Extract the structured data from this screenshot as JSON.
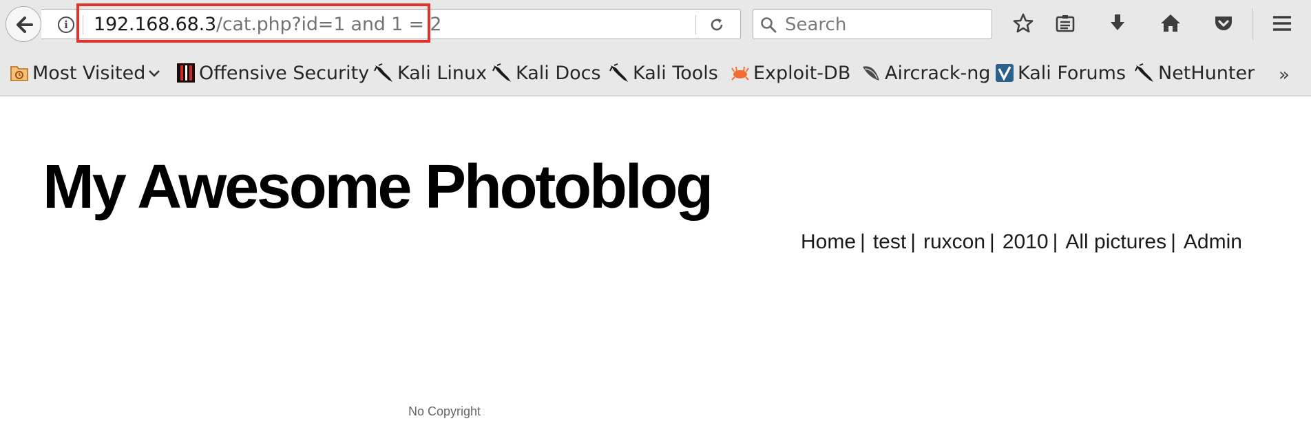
{
  "browser": {
    "url": {
      "host": "192.168.68.3",
      "path": "/cat.php?id=1 and 1 = 2"
    },
    "search": {
      "placeholder": "Search"
    },
    "toolbar_icons": [
      "bookmark-star-icon",
      "reading-list-icon",
      "downloads-icon",
      "home-icon",
      "pocket-icon",
      "menu-icon"
    ],
    "bookmarks": [
      {
        "label": "Most Visited",
        "icon": "most-visited-icon",
        "dropdown": true
      },
      {
        "label": "Offensive Security",
        "icon": "offsec-icon"
      },
      {
        "label": "Kali Linux",
        "icon": "kali-dragon-icon"
      },
      {
        "label": "Kali Docs",
        "icon": "kali-dragon-icon"
      },
      {
        "label": "Kali Tools",
        "icon": "kali-dragon-icon"
      },
      {
        "label": "Exploit-DB",
        "icon": "exploit-db-icon"
      },
      {
        "label": "Aircrack-ng",
        "icon": "aircrack-icon"
      },
      {
        "label": "Kali Forums",
        "icon": "kali-forums-icon"
      },
      {
        "label": "NetHunter",
        "icon": "kali-dragon-icon"
      }
    ],
    "overflow_label": "»",
    "highlight_color": "#e2302a"
  },
  "page": {
    "title": "My Awesome Photoblog",
    "nav": [
      "Home",
      "test",
      "ruxcon",
      "2010",
      "All pictures",
      "Admin"
    ],
    "nav_separator": "|",
    "footer": "No Copyright"
  }
}
